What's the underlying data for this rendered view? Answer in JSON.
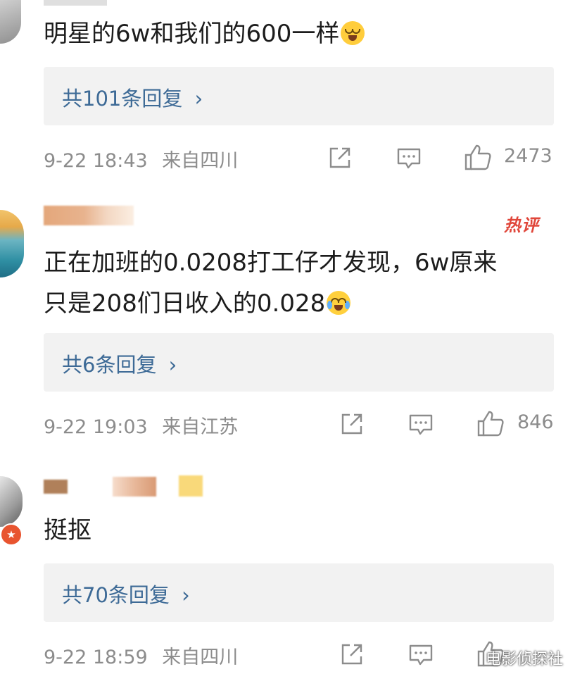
{
  "comments": [
    {
      "text": "明星的6w和我们的600一样",
      "replies": "共101条回复",
      "time": "9-22 18:43",
      "location": "来自四川",
      "likes": "2473"
    },
    {
      "text_line1": "正在加班的0.0208打工仔才发现，6w原来",
      "text_line2": "只是208们日收入的0.028",
      "badge": "热评",
      "replies": "共6条回复",
      "time": "9-22 19:03",
      "location": "来自江苏",
      "likes": "846"
    },
    {
      "text": "挺抠",
      "replies": "共70条回复",
      "time": "9-22 18:59",
      "location": "来自四川",
      "likes": ""
    }
  ],
  "reply_arrow": "›",
  "watermark": "电影侦探社",
  "colors": {
    "reply_blue": "#3d6a96",
    "meta_gray": "#8c8c8c",
    "hot_red": "#e0463a"
  }
}
